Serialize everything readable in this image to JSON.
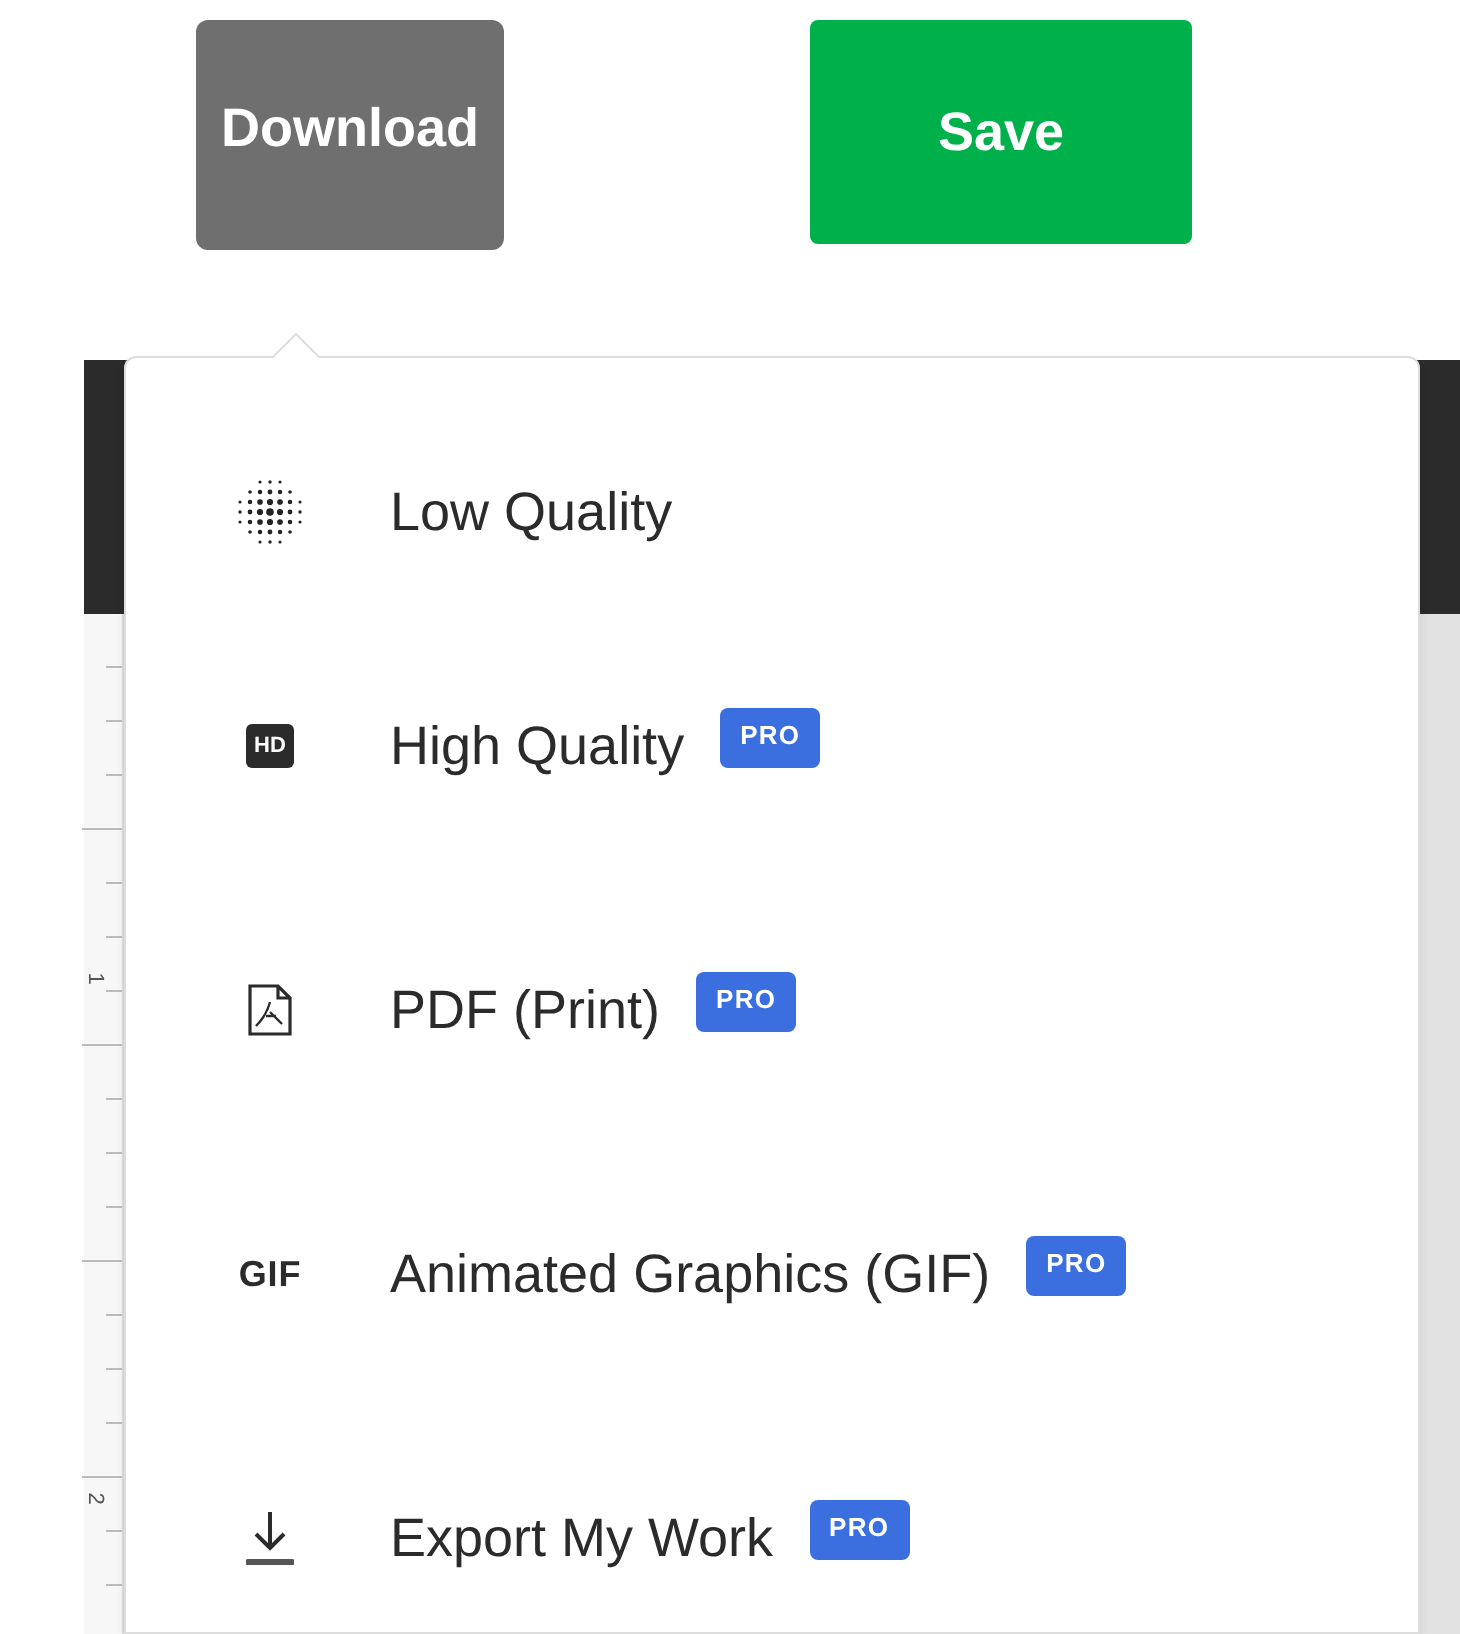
{
  "buttons": [
    {
      "label": "Download",
      "kind": "secondary"
    },
    {
      "label": "Save",
      "kind": "primary"
    }
  ],
  "ruler": {
    "labels": [
      "1",
      "2"
    ]
  },
  "menu": {
    "items": [
      {
        "label": "Low Quality",
        "kind": "dots"
      },
      {
        "label": "High Quality",
        "kind": "badge",
        "icon_text": "HD",
        "badge": "PRO"
      },
      {
        "label": "PDF (Print)",
        "kind": "pdf",
        "badge": "PRO"
      },
      {
        "label": "Animated Graphics (GIF)",
        "kind": "text",
        "icon_text": "GIF",
        "badge": "PRO"
      },
      {
        "label": "Export My Work",
        "kind": "download",
        "badge": "PRO"
      }
    ]
  }
}
